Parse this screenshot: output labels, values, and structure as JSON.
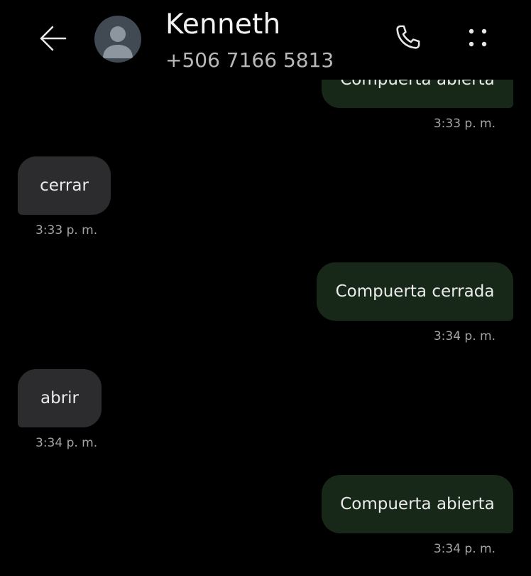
{
  "header": {
    "contact_name": "Kenneth",
    "contact_number": "+506 7166 5813",
    "icons": {
      "back": "arrow-left-icon",
      "avatar": "person-icon",
      "call": "phone-icon",
      "more": "four-dots-menu-icon"
    }
  },
  "colors": {
    "background": "#000000",
    "outgoing_bubble": "#172819",
    "incoming_bubble": "#2c2c2e",
    "timestamp": "#a6a6a6"
  },
  "messages": [
    {
      "direction": "outgoing",
      "text": "Compuerta abierta",
      "time": "3:33 p. m."
    },
    {
      "direction": "incoming",
      "text": "cerrar",
      "time": "3:33 p. m."
    },
    {
      "direction": "outgoing",
      "text": "Compuerta cerrada",
      "time": "3:34 p. m."
    },
    {
      "direction": "incoming",
      "text": "abrir",
      "time": "3:34 p. m."
    },
    {
      "direction": "outgoing",
      "text": "Compuerta abierta",
      "time": "3:34 p. m."
    }
  ]
}
